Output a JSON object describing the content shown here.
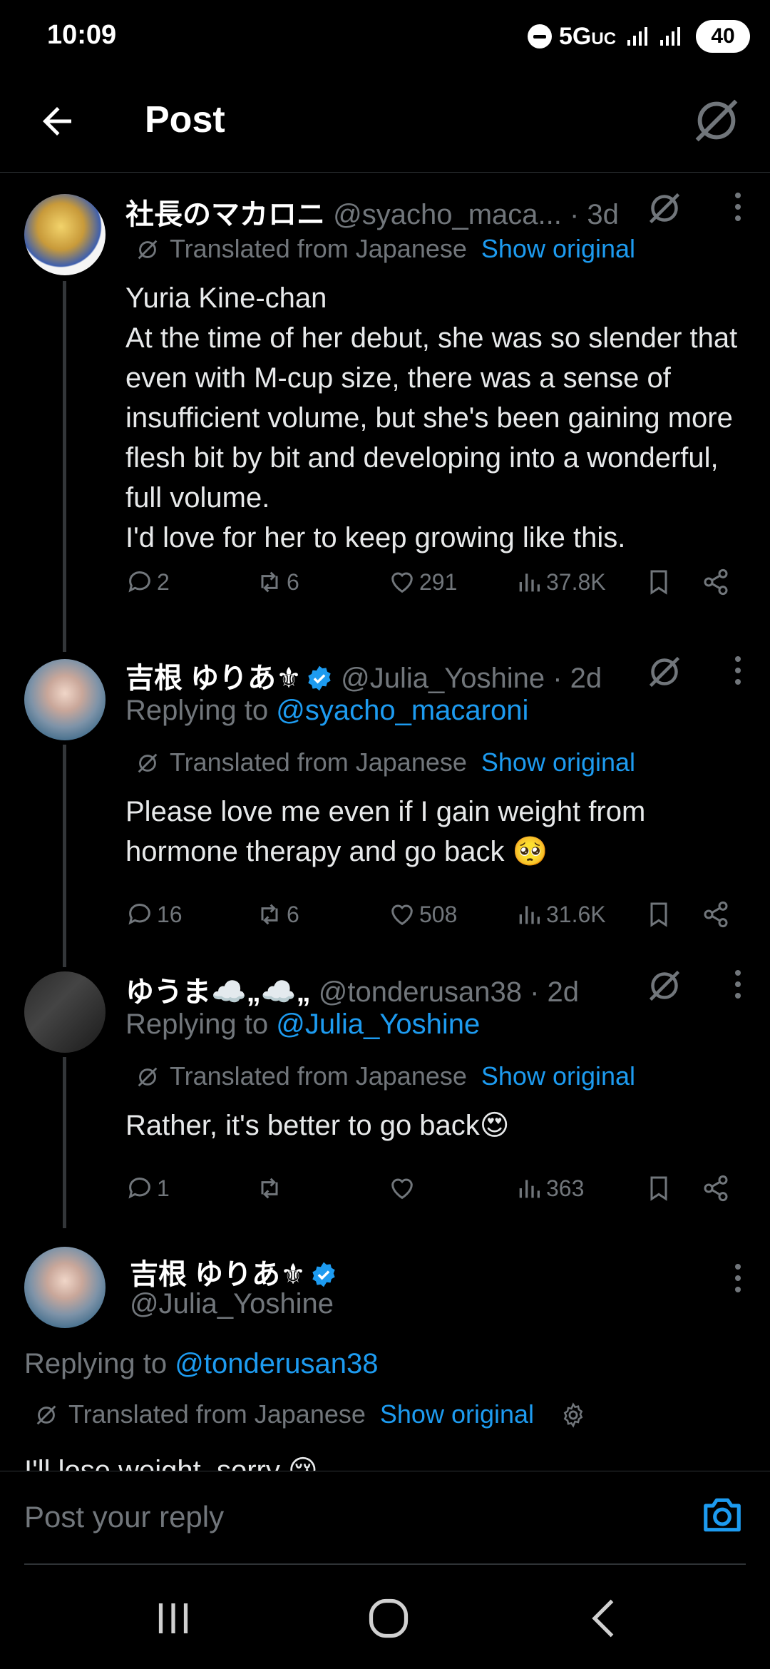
{
  "status_bar": {
    "time": "10:09",
    "network": "5G",
    "network_suffix": "UC",
    "battery": "40"
  },
  "header": {
    "title": "Post"
  },
  "posts": [
    {
      "name": "社長のマカロニ",
      "handle": "@syacho_maca...",
      "time": " · 3d",
      "verified": false,
      "translated_label": "Translated from Japanese",
      "show_original": "Show original",
      "body": [
        "Yuria Kine-chan",
        "At the time of her debut, she was so slender that even with M-cup size, there was a sense of insufficient volume, but she's been gaining more flesh bit by bit and developing into a wonderful, full volume.",
        "I'd love for her to keep growing like this."
      ],
      "stats": {
        "replies": "2",
        "reposts": "6",
        "likes": "291",
        "views": "37.8K"
      }
    },
    {
      "name": "吉根 ゆりあ⚜",
      "handle": "@Julia_Yoshine",
      "time": " · 2d",
      "verified": true,
      "replying_prefix": "Replying to ",
      "replying_to": "@syacho_macaroni",
      "translated_label": "Translated from Japanese",
      "show_original": "Show original",
      "body": [
        "Please love me even if I gain weight from hormone therapy and go back 🥺"
      ],
      "stats": {
        "replies": "16",
        "reposts": "6",
        "likes": "508",
        "views": "31.6K"
      }
    },
    {
      "name": "ゆうま☁️„☁️„",
      "handle": "@tonderusan38",
      "time": " · 2d",
      "verified": false,
      "replying_prefix": "Replying to ",
      "replying_to": "@Julia_Yoshine",
      "translated_label": "Translated from Japanese",
      "show_original": "Show original",
      "body": [
        "Rather, it's better to go back😍"
      ],
      "stats": {
        "replies": "1",
        "reposts": "",
        "likes": "",
        "views": "363"
      }
    },
    {
      "name": "吉根 ゆりあ⚜",
      "handle": "@Julia_Yoshine",
      "verified": true,
      "replying_prefix": "Replying to ",
      "replying_to": "@tonderusan38",
      "translated_label": "Translated from Japanese",
      "show_original": "Show original",
      "body_partial": "I'll lose weight, sorry 😢"
    }
  ],
  "composer": {
    "placeholder": "Post your reply"
  },
  "colors": {
    "accent": "#1d9bf0",
    "muted": "#71767b",
    "text": "#e7e9ea",
    "background": "#000000"
  }
}
